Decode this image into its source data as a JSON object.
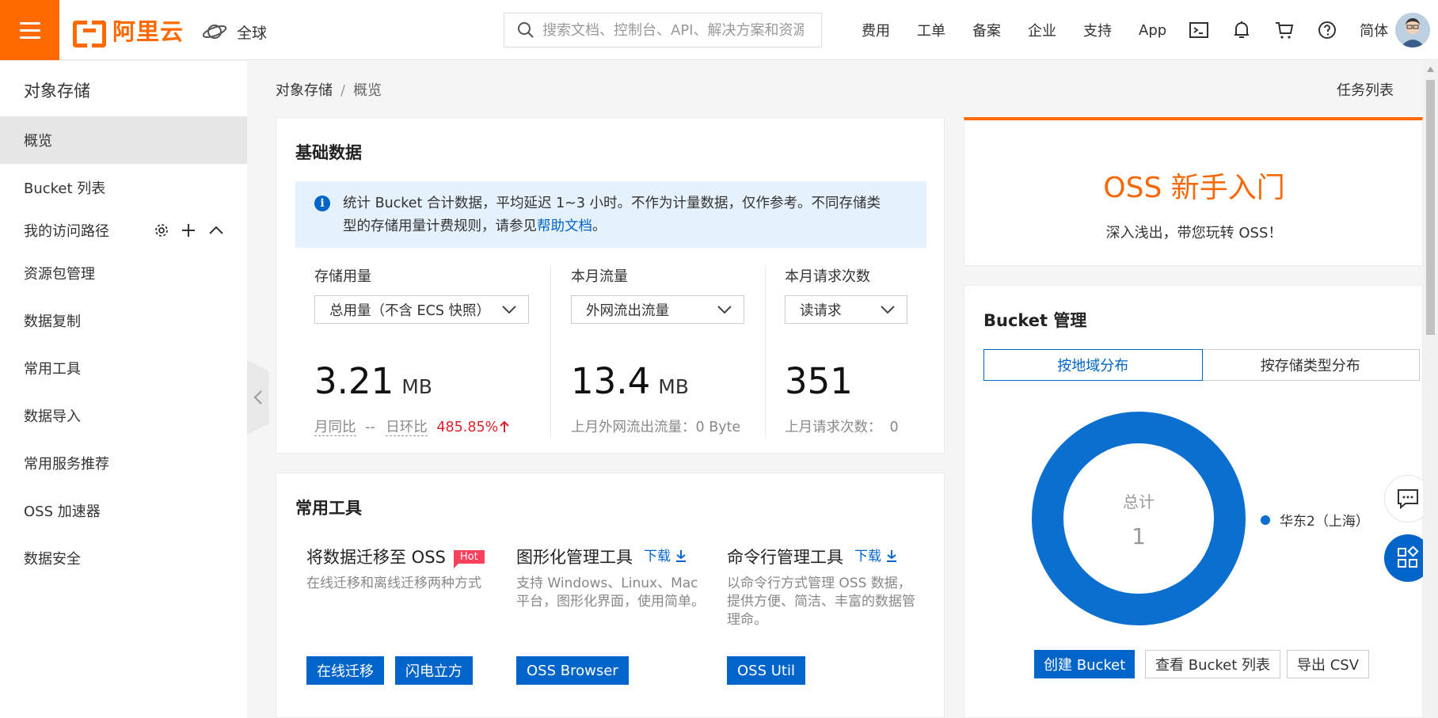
{
  "topbar": {
    "logo_text": "阿里云",
    "region": "全球",
    "search_placeholder": "搜索文档、控制台、API、解决方案和资源",
    "nav": [
      "费用",
      "工单",
      "备案",
      "企业",
      "支持",
      "App"
    ],
    "lang": "简体"
  },
  "sidebar": {
    "title": "对象存储",
    "items": [
      "概览",
      "Bucket 列表",
      "我的访问路径",
      "资源包管理",
      "数据复制",
      "常用工具",
      "数据导入",
      "常用服务推荐",
      "OSS 加速器",
      "数据安全"
    ]
  },
  "breadcrumb": {
    "root": "对象存储",
    "sep": "/",
    "current": "概览"
  },
  "task_list": "任务列表",
  "basic_data": {
    "title": "基础数据",
    "info_text_1": "统计 Bucket 合计数据，平均延迟 1~3 小时。不作为计量数据，仅作参考。不同存储类",
    "info_text_2": "型的存储用量计费规则，请参见",
    "info_link": "帮助文档",
    "info_end": "。",
    "storage": {
      "label": "存储用量",
      "select": "总用量（不含 ECS 快照）",
      "value": "3.21",
      "unit": "MB",
      "mom_label": "月同比",
      "mom_value": "--",
      "dod_label": "日环比",
      "dod_value": "485.85%"
    },
    "traffic": {
      "label": "本月流量",
      "select": "外网流出流量",
      "value": "13.4",
      "unit": "MB",
      "sub": "上月外网流出流量：0 Byte"
    },
    "requests": {
      "label": "本月请求次数",
      "select": "读请求",
      "value": "351",
      "sub_label": "上月请求次数：",
      "sub_value": "0"
    }
  },
  "tools": {
    "title": "常用工具",
    "migrate": {
      "title": "将数据迁移至 OSS",
      "badge": "Hot",
      "desc": "在线迁移和离线迁移两种方式",
      "btn1": "在线迁移",
      "btn2": "闪电立方"
    },
    "gui": {
      "title": "图形化管理工具",
      "download": "下载",
      "desc": "支持 Windows、Linux、Mac 平台，图形化界面，使用简单。",
      "btn": "OSS Browser"
    },
    "cli": {
      "title": "命令行管理工具",
      "download": "下载",
      "desc": "以命令行方式管理 OSS 数据，提供方便、简洁、丰富的数据管理命。",
      "btn": "OSS Util"
    }
  },
  "oss_intro": {
    "title": "OSS 新手入门",
    "subtitle": "深入浅出，带您玩转 OSS！"
  },
  "bucket_mgmt": {
    "title": "Bucket 管理",
    "tabs": [
      "按地域分布",
      "按存储类型分布"
    ],
    "donut_label": "总计",
    "donut_total": "1",
    "legend": "华东2（上海）",
    "buttons": [
      "创建 Bucket",
      "查看 Bucket 列表",
      "导出 CSV"
    ]
  },
  "colors": {
    "accent": "#ff6a00",
    "primary": "#0064c8",
    "oss_title": "#f5690a",
    "up_red": "#e0212b"
  }
}
